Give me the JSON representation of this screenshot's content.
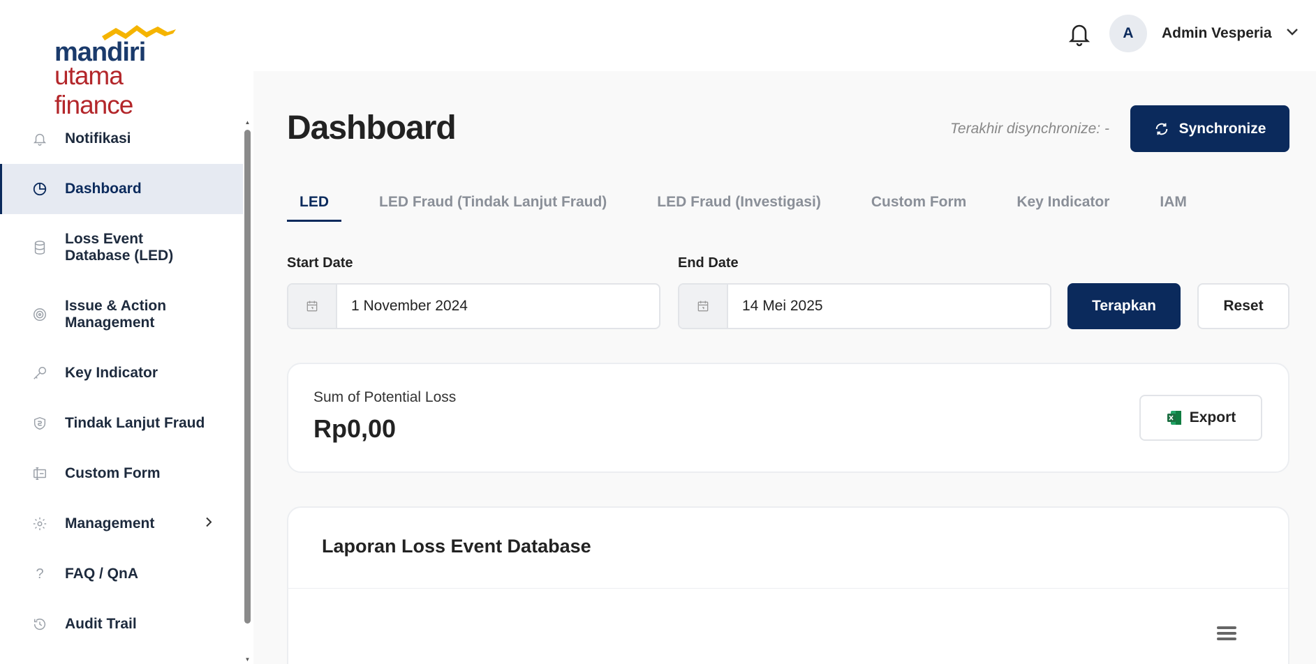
{
  "brand": {
    "line1": "mandiri",
    "line2": "utama finance",
    "accent": "#f5b400"
  },
  "sidebar": {
    "items": [
      {
        "label": "Notifikasi",
        "icon": "bell-icon"
      },
      {
        "label": "Dashboard",
        "icon": "pie-chart-icon"
      },
      {
        "label": "Loss Event Database (LED)",
        "icon": "database-icon"
      },
      {
        "label": "Issue & Action Management",
        "icon": "target-icon"
      },
      {
        "label": "Key Indicator",
        "icon": "key-icon"
      },
      {
        "label": "Tindak Lanjut Fraud",
        "icon": "shield-dollar-icon"
      },
      {
        "label": "Custom Form",
        "icon": "form-icon"
      },
      {
        "label": "Management",
        "icon": "gear-icon"
      },
      {
        "label": "FAQ / QnA",
        "icon": "question-icon"
      },
      {
        "label": "Audit Trail",
        "icon": "history-icon"
      }
    ]
  },
  "header": {
    "user_initial": "A",
    "user_name": "Admin Vesperia"
  },
  "main": {
    "title": "Dashboard",
    "sync_status": "Terakhir disynchronize: -",
    "sync_button": "Synchronize",
    "tabs": [
      "LED",
      "LED Fraud (Tindak Lanjut Fraud)",
      "LED Fraud (Investigasi)",
      "Custom Form",
      "Key Indicator",
      "IAM"
    ],
    "filters": {
      "start_label": "Start Date",
      "start_value": "1 November 2024",
      "end_label": "End Date",
      "end_value": "14 Mei 2025",
      "apply": "Terapkan",
      "reset": "Reset"
    },
    "summary": {
      "label": "Sum of Potential Loss",
      "value": "Rp0,00",
      "export": "Export"
    },
    "report": {
      "title": "Laporan Loss Event Database"
    }
  },
  "colors": {
    "primary": "#0b2a5c",
    "excel": "#1d6f42"
  }
}
